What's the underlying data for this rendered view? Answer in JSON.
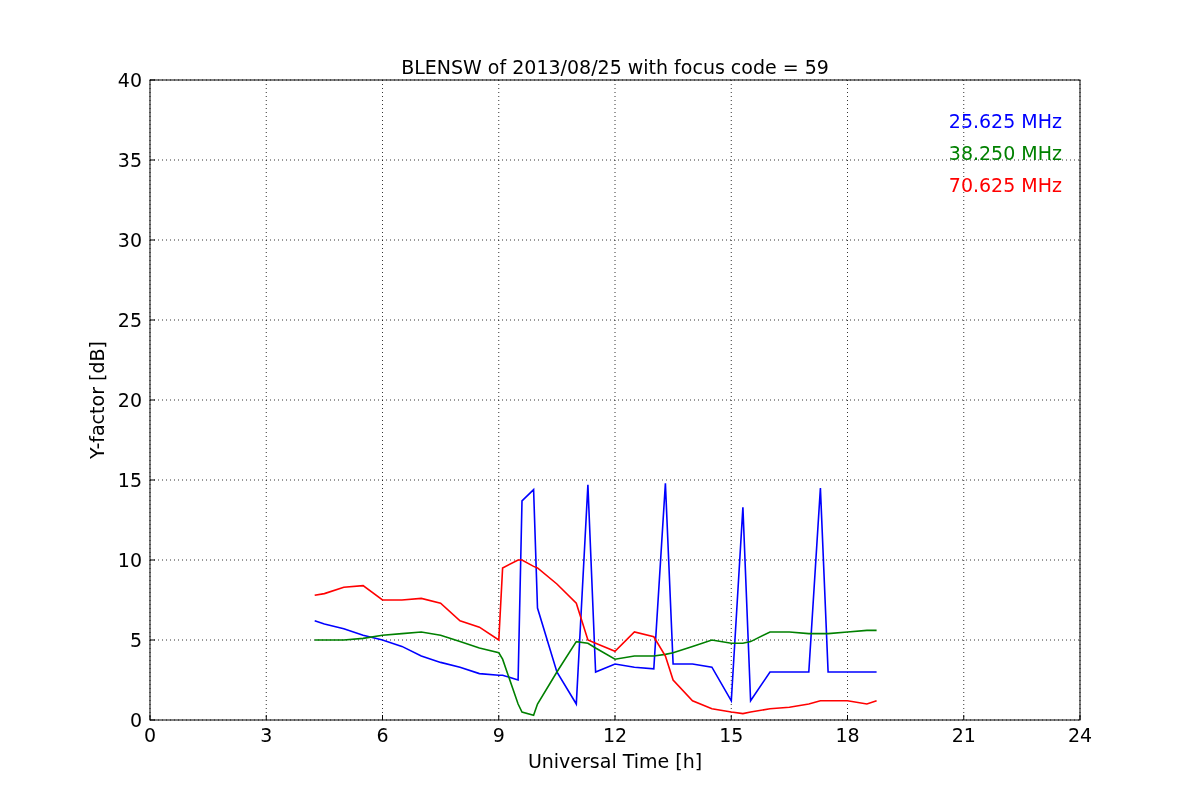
{
  "figure": {
    "chart_data": {
      "type": "line",
      "title": "BLENSW of 2013/08/25 with focus code = 59",
      "xlabel": "Universal Time [h]",
      "ylabel": "Y-factor [dB]",
      "x": [
        4.25,
        4.5,
        5,
        5.5,
        6,
        6.5,
        7,
        7.5,
        8,
        8.5,
        9,
        9.1,
        9.5,
        9.6,
        9.9,
        10,
        10.5,
        11,
        11.3,
        11.5,
        12,
        12.5,
        13,
        13.3,
        13.5,
        14,
        14.5,
        15,
        15.3,
        15.5,
        16,
        16.5,
        17,
        17.3,
        17.5,
        18,
        18.5,
        18.75
      ],
      "series": [
        {
          "name": "25.625 MHz",
          "color": "#0000ff",
          "values": [
            6.2,
            6,
            5.7,
            5.3,
            5,
            4.6,
            4,
            3.6,
            3.3,
            2.9,
            2.8,
            2.8,
            2.5,
            13.7,
            14.4,
            7,
            3,
            1,
            14.7,
            3,
            3.5,
            3.3,
            3.2,
            14.8,
            3.5,
            3.5,
            3.3,
            1.2,
            13.3,
            1.2,
            3,
            3,
            3,
            14.5,
            3,
            3,
            3,
            3
          ]
        },
        {
          "name": "38.250 MHz",
          "color": "#008000",
          "values": [
            5,
            5,
            5,
            5.1,
            5.3,
            5.4,
            5.5,
            5.3,
            4.9,
            4.5,
            4.2,
            3.8,
            1,
            0.5,
            0.3,
            1,
            3,
            4.9,
            4.8,
            4.5,
            3.8,
            4,
            4,
            4.1,
            4.2,
            4.6,
            5,
            4.8,
            4.8,
            4.9,
            5.5,
            5.5,
            5.4,
            5.4,
            5.4,
            5.5,
            5.6,
            5.6
          ]
        },
        {
          "name": "70.625 MHz",
          "color": "#ff0000",
          "values": [
            7.8,
            7.9,
            8.3,
            8.4,
            7.5,
            7.5,
            7.6,
            7.3,
            6.2,
            5.8,
            5,
            9.5,
            10,
            10,
            9.6,
            9.5,
            8.5,
            7.3,
            5,
            4.8,
            4.3,
            5.5,
            5.2,
            4,
            2.5,
            1.2,
            0.7,
            0.5,
            0.4,
            0.5,
            0.7,
            0.8,
            1,
            1.2,
            1.2,
            1.2,
            1,
            1.2
          ]
        }
      ],
      "grid": true,
      "xlim": [
        0,
        24
      ],
      "ylim": [
        0,
        40
      ],
      "xticks": [
        0,
        3,
        6,
        9,
        12,
        15,
        18,
        21,
        24
      ],
      "yticks": [
        0,
        5,
        10,
        15,
        20,
        25,
        30,
        35,
        40
      ]
    }
  }
}
